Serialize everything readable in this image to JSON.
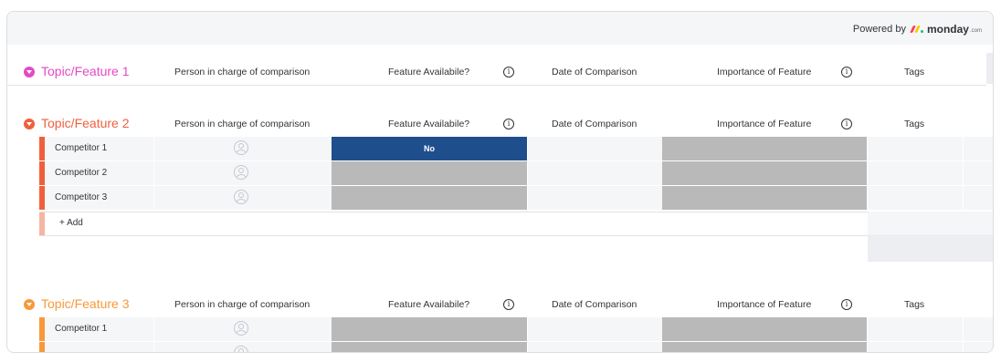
{
  "header": {
    "powered_by": "Powered by",
    "logo_text": "monday",
    "logo_suffix": ".com",
    "logo_colors": [
      "#ff3d57",
      "#ffcb00",
      "#00ca72"
    ]
  },
  "columns": {
    "person": "Person in charge of comparison",
    "feature": "Feature Availabile?",
    "date": "Date of Comparison",
    "importance": "Importance of Feature",
    "tags": "Tags",
    "info_glyph": "i"
  },
  "groups": [
    {
      "title": "Topic/Feature 1",
      "color": "#e44ac5",
      "collapsed": true,
      "rows": []
    },
    {
      "title": "Topic/Feature 2",
      "color": "#f05f3c",
      "rows": [
        {
          "name": "Competitor 1",
          "feature_status": "No",
          "feature_status_color": "#1f4e8c"
        },
        {
          "name": "Competitor 2",
          "feature_status": ""
        },
        {
          "name": "Competitor 3",
          "feature_status": ""
        }
      ],
      "add_label": "+ Add"
    },
    {
      "title": "Topic/Feature 3",
      "color": "#f7993b",
      "rows": [
        {
          "name": "Competitor 1",
          "feature_status": ""
        }
      ]
    }
  ]
}
